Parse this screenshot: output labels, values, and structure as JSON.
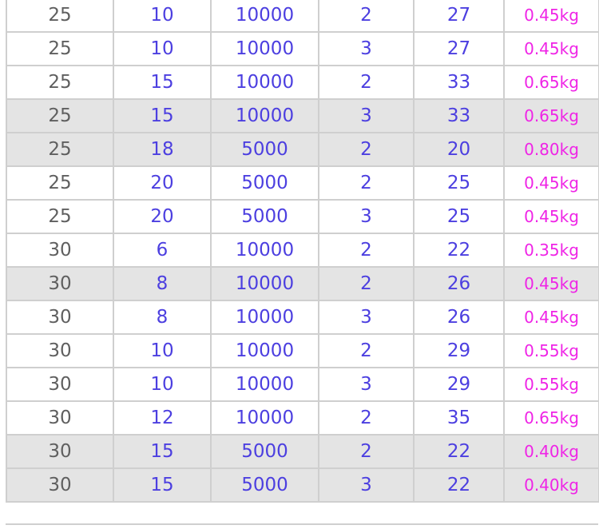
{
  "colors": {
    "grid_line": "#cfcfcf",
    "shaded_row": "#e4e4e4",
    "first_column_text": "#5f5f5f",
    "middle_columns_text": "#4c3fe0",
    "weight_text": "#ef24e6"
  },
  "table": {
    "rows": [
      {
        "shaded": false,
        "cells": [
          "25",
          "10",
          "10000",
          "2",
          "27",
          "0.45kg"
        ]
      },
      {
        "shaded": false,
        "cells": [
          "25",
          "10",
          "10000",
          "3",
          "27",
          "0.45kg"
        ]
      },
      {
        "shaded": false,
        "cells": [
          "25",
          "15",
          "10000",
          "2",
          "33",
          "0.65kg"
        ]
      },
      {
        "shaded": true,
        "cells": [
          "25",
          "15",
          "10000",
          "3",
          "33",
          "0.65kg"
        ]
      },
      {
        "shaded": true,
        "cells": [
          "25",
          "18",
          "5000",
          "2",
          "20",
          "0.80kg"
        ]
      },
      {
        "shaded": false,
        "cells": [
          "25",
          "20",
          "5000",
          "2",
          "25",
          "0.45kg"
        ]
      },
      {
        "shaded": false,
        "cells": [
          "25",
          "20",
          "5000",
          "3",
          "25",
          "0.45kg"
        ]
      },
      {
        "shaded": false,
        "cells": [
          "30",
          "6",
          "10000",
          "2",
          "22",
          "0.35kg"
        ]
      },
      {
        "shaded": true,
        "cells": [
          "30",
          "8",
          "10000",
          "2",
          "26",
          "0.45kg"
        ]
      },
      {
        "shaded": false,
        "cells": [
          "30",
          "8",
          "10000",
          "3",
          "26",
          "0.45kg"
        ]
      },
      {
        "shaded": false,
        "cells": [
          "30",
          "10",
          "10000",
          "2",
          "29",
          "0.55kg"
        ]
      },
      {
        "shaded": false,
        "cells": [
          "30",
          "10",
          "10000",
          "3",
          "29",
          "0.55kg"
        ]
      },
      {
        "shaded": false,
        "cells": [
          "30",
          "12",
          "10000",
          "2",
          "35",
          "0.65kg"
        ]
      },
      {
        "shaded": true,
        "cells": [
          "30",
          "15",
          "5000",
          "2",
          "22",
          "0.40kg"
        ]
      },
      {
        "shaded": true,
        "cells": [
          "30",
          "15",
          "5000",
          "3",
          "22",
          "0.40kg"
        ]
      }
    ]
  }
}
